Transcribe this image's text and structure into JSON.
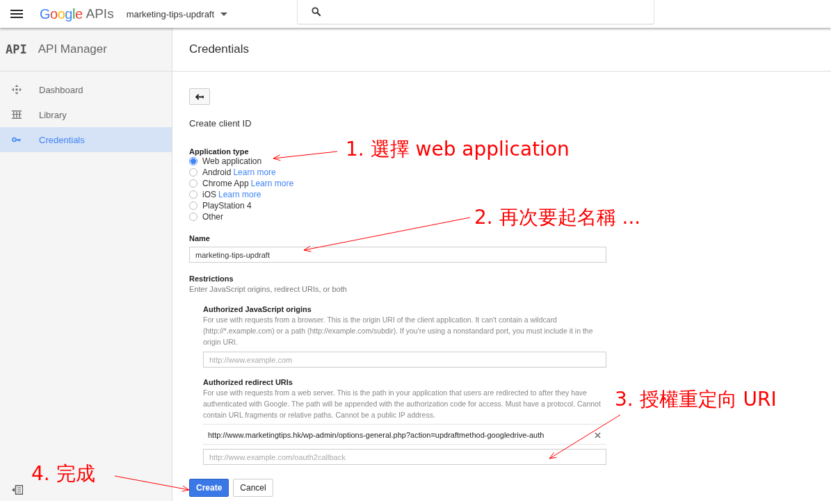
{
  "header": {
    "logo_word": "Google",
    "logo_suffix": "APIs",
    "project": "marketing-tips-updraft"
  },
  "sidebar": {
    "logo": "API",
    "title": "API Manager",
    "items": [
      {
        "label": "Dashboard",
        "selected": false
      },
      {
        "label": "Library",
        "selected": false
      },
      {
        "label": "Credentials",
        "selected": true
      }
    ]
  },
  "main": {
    "title": "Credentials",
    "subtitle": "Create client ID",
    "app_type": {
      "label": "Application type",
      "options": [
        {
          "label": "Web application",
          "selected": true
        },
        {
          "label": "Android",
          "link": "Learn more",
          "selected": false
        },
        {
          "label": "Chrome App",
          "link": "Learn more",
          "selected": false
        },
        {
          "label": "iOS",
          "link": "Learn more",
          "selected": false
        },
        {
          "label": "PlayStation 4",
          "selected": false
        },
        {
          "label": "Other",
          "selected": false
        }
      ]
    },
    "name": {
      "label": "Name",
      "value": "marketing-tips-updraft"
    },
    "restrictions": {
      "title": "Restrictions",
      "hint": "Enter JavaScript origins, redirect URIs, or both",
      "js_origins": {
        "title": "Authorized JavaScript origins",
        "description": "For use with requests from a browser. This is the origin URI of the client application. It can't contain a wildcard (http://*.example.com) or a path (http://example.com/subdir). If you're using a nonstandard port, you must include it in the origin URI.",
        "placeholder": "http://www.example.com"
      },
      "redirect": {
        "title": "Authorized redirect URIs",
        "description": "For use with requests from a web server. This is the path in your application that users are redirected to after they have authenticated with Google. The path will be appended with the authorization code for access. Must have a protocol. Cannot contain URL fragments or relative paths. Cannot be a public IP address.",
        "uris": [
          "http://www.marketingtips.hk/wp-admin/options-general.php?action=updraftmethod-googledrive-auth"
        ],
        "placeholder": "http://www.example.com/oauth2callback"
      }
    },
    "buttons": [
      "Create",
      "Cancel"
    ]
  },
  "annotations": [
    "1. 選擇 web application",
    "2. 再次要起名稱 ...",
    "3. 授權重定向 URI",
    "4. 完成"
  ]
}
